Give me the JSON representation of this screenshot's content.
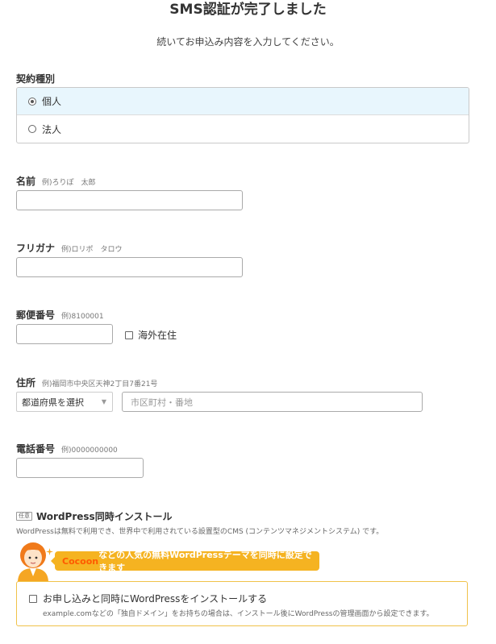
{
  "header": {
    "title": "SMS認証が完了しました",
    "subtitle": "続いてお申込み内容を入力してください。"
  },
  "contract": {
    "label": "契約種別",
    "options": [
      "個人",
      "法人"
    ],
    "selected": "個人"
  },
  "name": {
    "label": "名前",
    "example": "例)ろりぽ　太郎",
    "value": ""
  },
  "furigana": {
    "label": "フリガナ",
    "example": "例)ロリポ　タロウ",
    "value": ""
  },
  "postal": {
    "label": "郵便番号",
    "example": "例)8100001",
    "value": "",
    "overseas_label": "海外在住"
  },
  "address": {
    "label": "住所",
    "example": "例)福岡市中央区天神2丁目7番21号",
    "prefecture_selected": "都道府県を選択",
    "city_placeholder": "市区町村・番地"
  },
  "phone": {
    "label": "電話番号",
    "example": "例)0000000000",
    "value": ""
  },
  "wordpress": {
    "badge": "任意",
    "heading": "WordPress同時インストール",
    "description": "WordPressは無料で利用でき、世界中で利用されている設置型のCMS (コンテンツマネジメントシステム) です。",
    "banner_highlight": "Cocoon",
    "banner_text": "などの人気の無料WordPressテーマを同時に設定できます",
    "checkbox_label": "お申し込みと同時にWordPressをインストールする",
    "note": "example.comなどの「独自ドメイン」をお持ちの場合は、インストール後にWordPressの管理画面から設定できます。"
  },
  "colors": {
    "accent_blue_bg": "#e8f6fd",
    "banner_orange": "#f5b321",
    "cocoon_orange": "#ff5a00",
    "wp_border": "#f0c24a"
  },
  "icons": {
    "mascot": "mascot-avatar-icon",
    "sparkle": "sparkle-icon"
  }
}
